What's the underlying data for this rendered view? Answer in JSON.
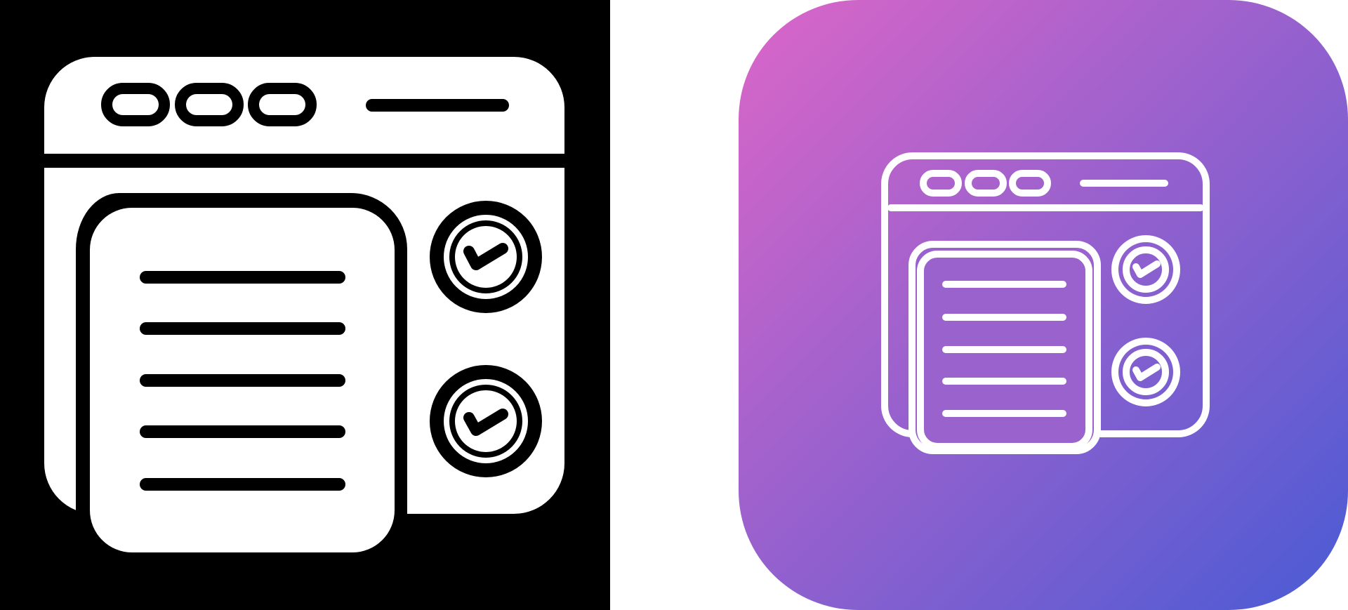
{
  "colors": {
    "glyph_background": "#000000",
    "page_background": "#ffffff",
    "glyph_fill": "#ffffff",
    "glyph_stroke": "#000000",
    "gradient_top_left": "#dc66c8",
    "gradient_bottom_right": "#4a5bd4",
    "line_icon_stroke": "#ffffff"
  },
  "icons": {
    "glyph_variant": "web-document-checklist-icon",
    "line_variant": "web-document-checklist-icon"
  }
}
